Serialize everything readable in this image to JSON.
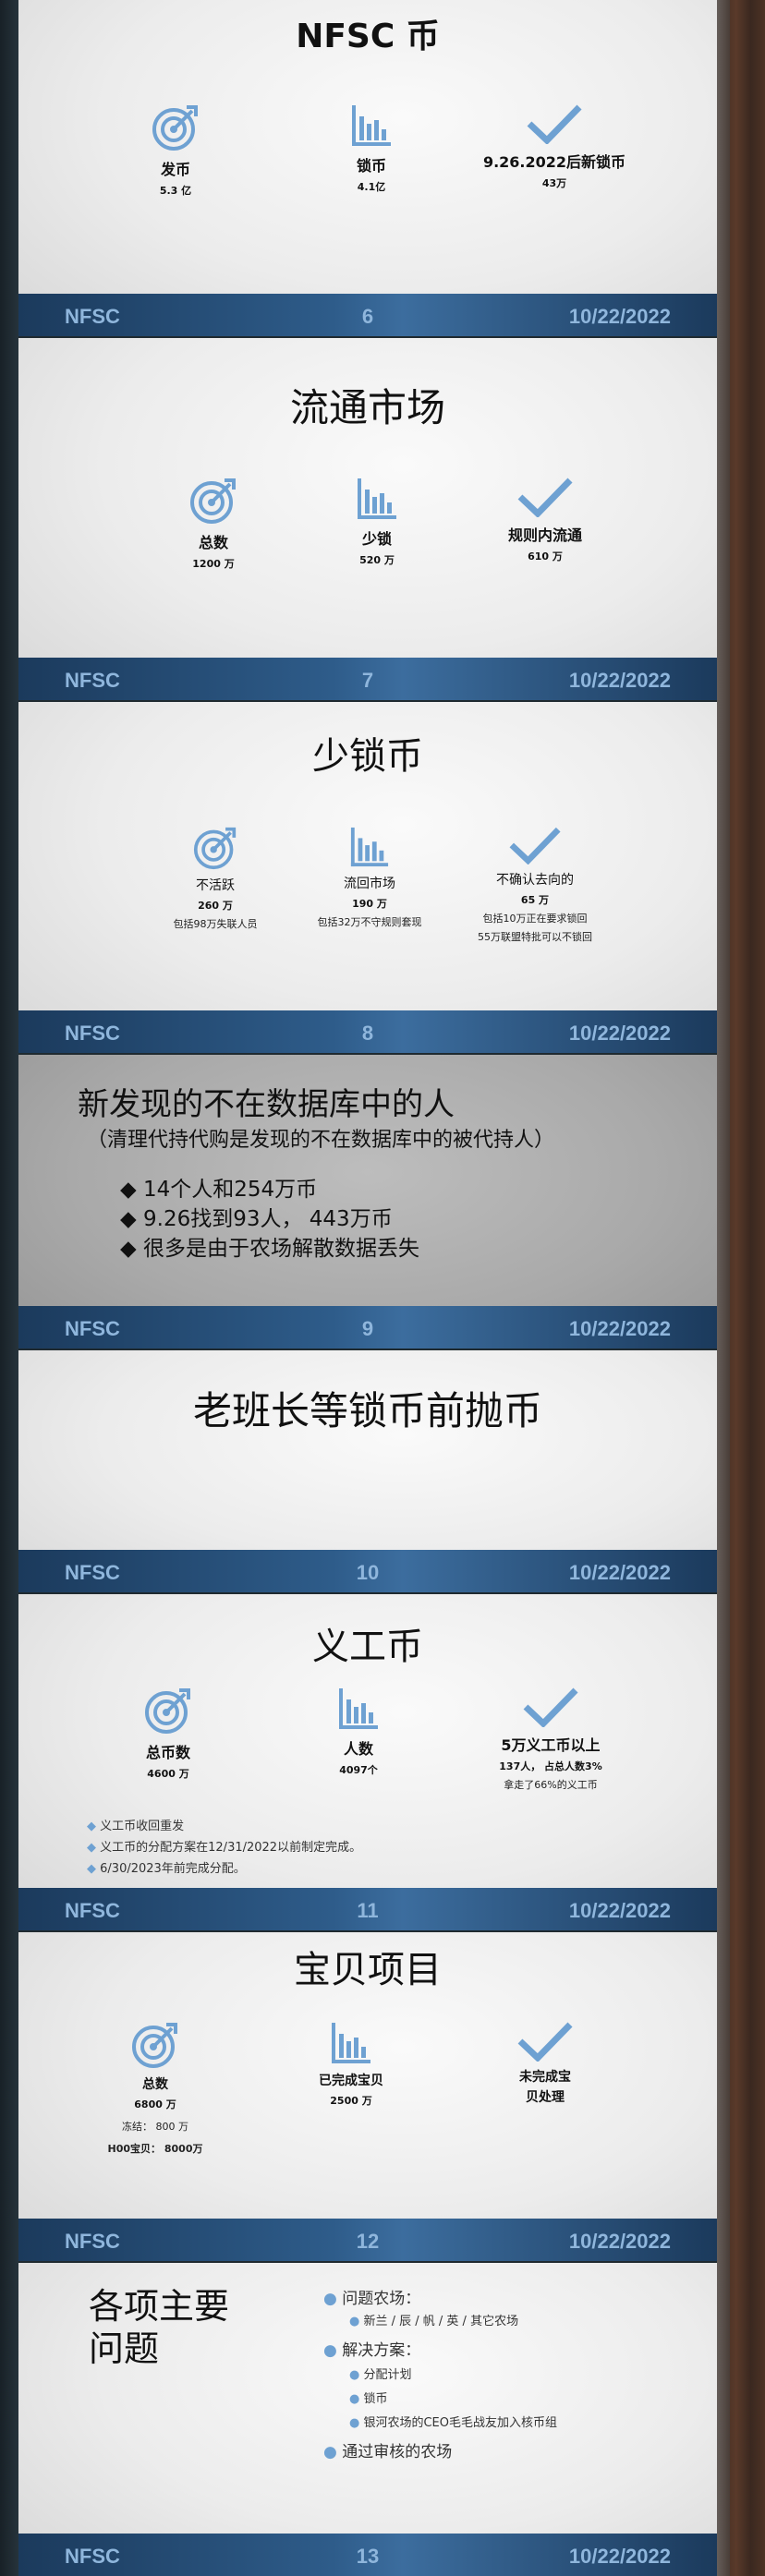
{
  "footer": {
    "org": "NFSC",
    "date": "10/22/2022"
  },
  "s6": {
    "title": "NFSC 币",
    "page": "6",
    "items": [
      {
        "label": "发币",
        "value": "5.3 亿"
      },
      {
        "label": "锁币",
        "value": "4.1亿"
      },
      {
        "label": "9.26.2022后新锁币",
        "value": "43万"
      }
    ]
  },
  "s7": {
    "title": "流通市场",
    "page": "7",
    "items": [
      {
        "label": "总数",
        "value": "1200 万"
      },
      {
        "label": "少锁",
        "value": "520 万"
      },
      {
        "label": "规则内流通",
        "value": "610 万"
      }
    ]
  },
  "s8": {
    "title": "少锁币",
    "page": "8",
    "items": [
      {
        "label": "不活跃",
        "value": "260 万",
        "sub": "包括98万失联人员"
      },
      {
        "label": "流回市场",
        "value": "190 万",
        "sub": "包括32万不守规则套现"
      },
      {
        "label": "不确认去向的",
        "value": "65 万",
        "sub": "包括10万正在要求锁回",
        "sub2": "55万联盟特批可以不锁回"
      }
    ]
  },
  "s9": {
    "title": "新发现的不在数据库中的人",
    "subtitle": "（清理代持代购是发现的不在数据库中的被代持人）",
    "page": "9",
    "bullets": [
      "◆ 14个人和254万币",
      "◆ 9.26找到93人， 443万币",
      "◆ 很多是由于农场解散数据丢失"
    ]
  },
  "s10": {
    "title": "老班长等锁币前抛币",
    "page": "10"
  },
  "s11": {
    "title": "义工币",
    "page": "11",
    "items": [
      {
        "label": "总币数",
        "value": "4600 万"
      },
      {
        "label": "人数",
        "value": "4097个"
      },
      {
        "label": "5万义工币以上",
        "value": "137人， 占总人数3%",
        "sub": "拿走了66%的义工币"
      }
    ],
    "bullets": [
      "义工币收回重发",
      "义工币的分配方案在12/31/2022以前制定完成。",
      "6/30/2023年前完成分配。"
    ]
  },
  "s12": {
    "title": "宝贝项目",
    "page": "12",
    "items": [
      {
        "label": "总数",
        "value": "6800 万",
        "sub": "冻结： 800 万",
        "sub2": "H00宝贝： 8000万"
      },
      {
        "label": "已完成宝贝",
        "value": "2500 万"
      },
      {
        "label": "未完成宝",
        "label2": "贝处理"
      }
    ]
  },
  "s13": {
    "title1": "各项主要",
    "title2": "问题",
    "page": "13",
    "list": [
      {
        "level": 1,
        "text": "问题农场："
      },
      {
        "level": 2,
        "text": "新兰 / 辰 / 帆 / 英 / 其它农场"
      },
      {
        "level": 1,
        "text": "解决方案："
      },
      {
        "level": 2,
        "text": "分配计划"
      },
      {
        "level": 2,
        "text": "锁币"
      },
      {
        "level": 2,
        "text": "银河农场的CEO毛毛战友加入核币组"
      },
      {
        "level": 1,
        "text": "通过审核的农场"
      }
    ]
  },
  "icons": {
    "col1": "target-icon",
    "col2": "bar-chart-icon",
    "col3": "checkmark-icon",
    "accent": "#6ea1d2"
  }
}
